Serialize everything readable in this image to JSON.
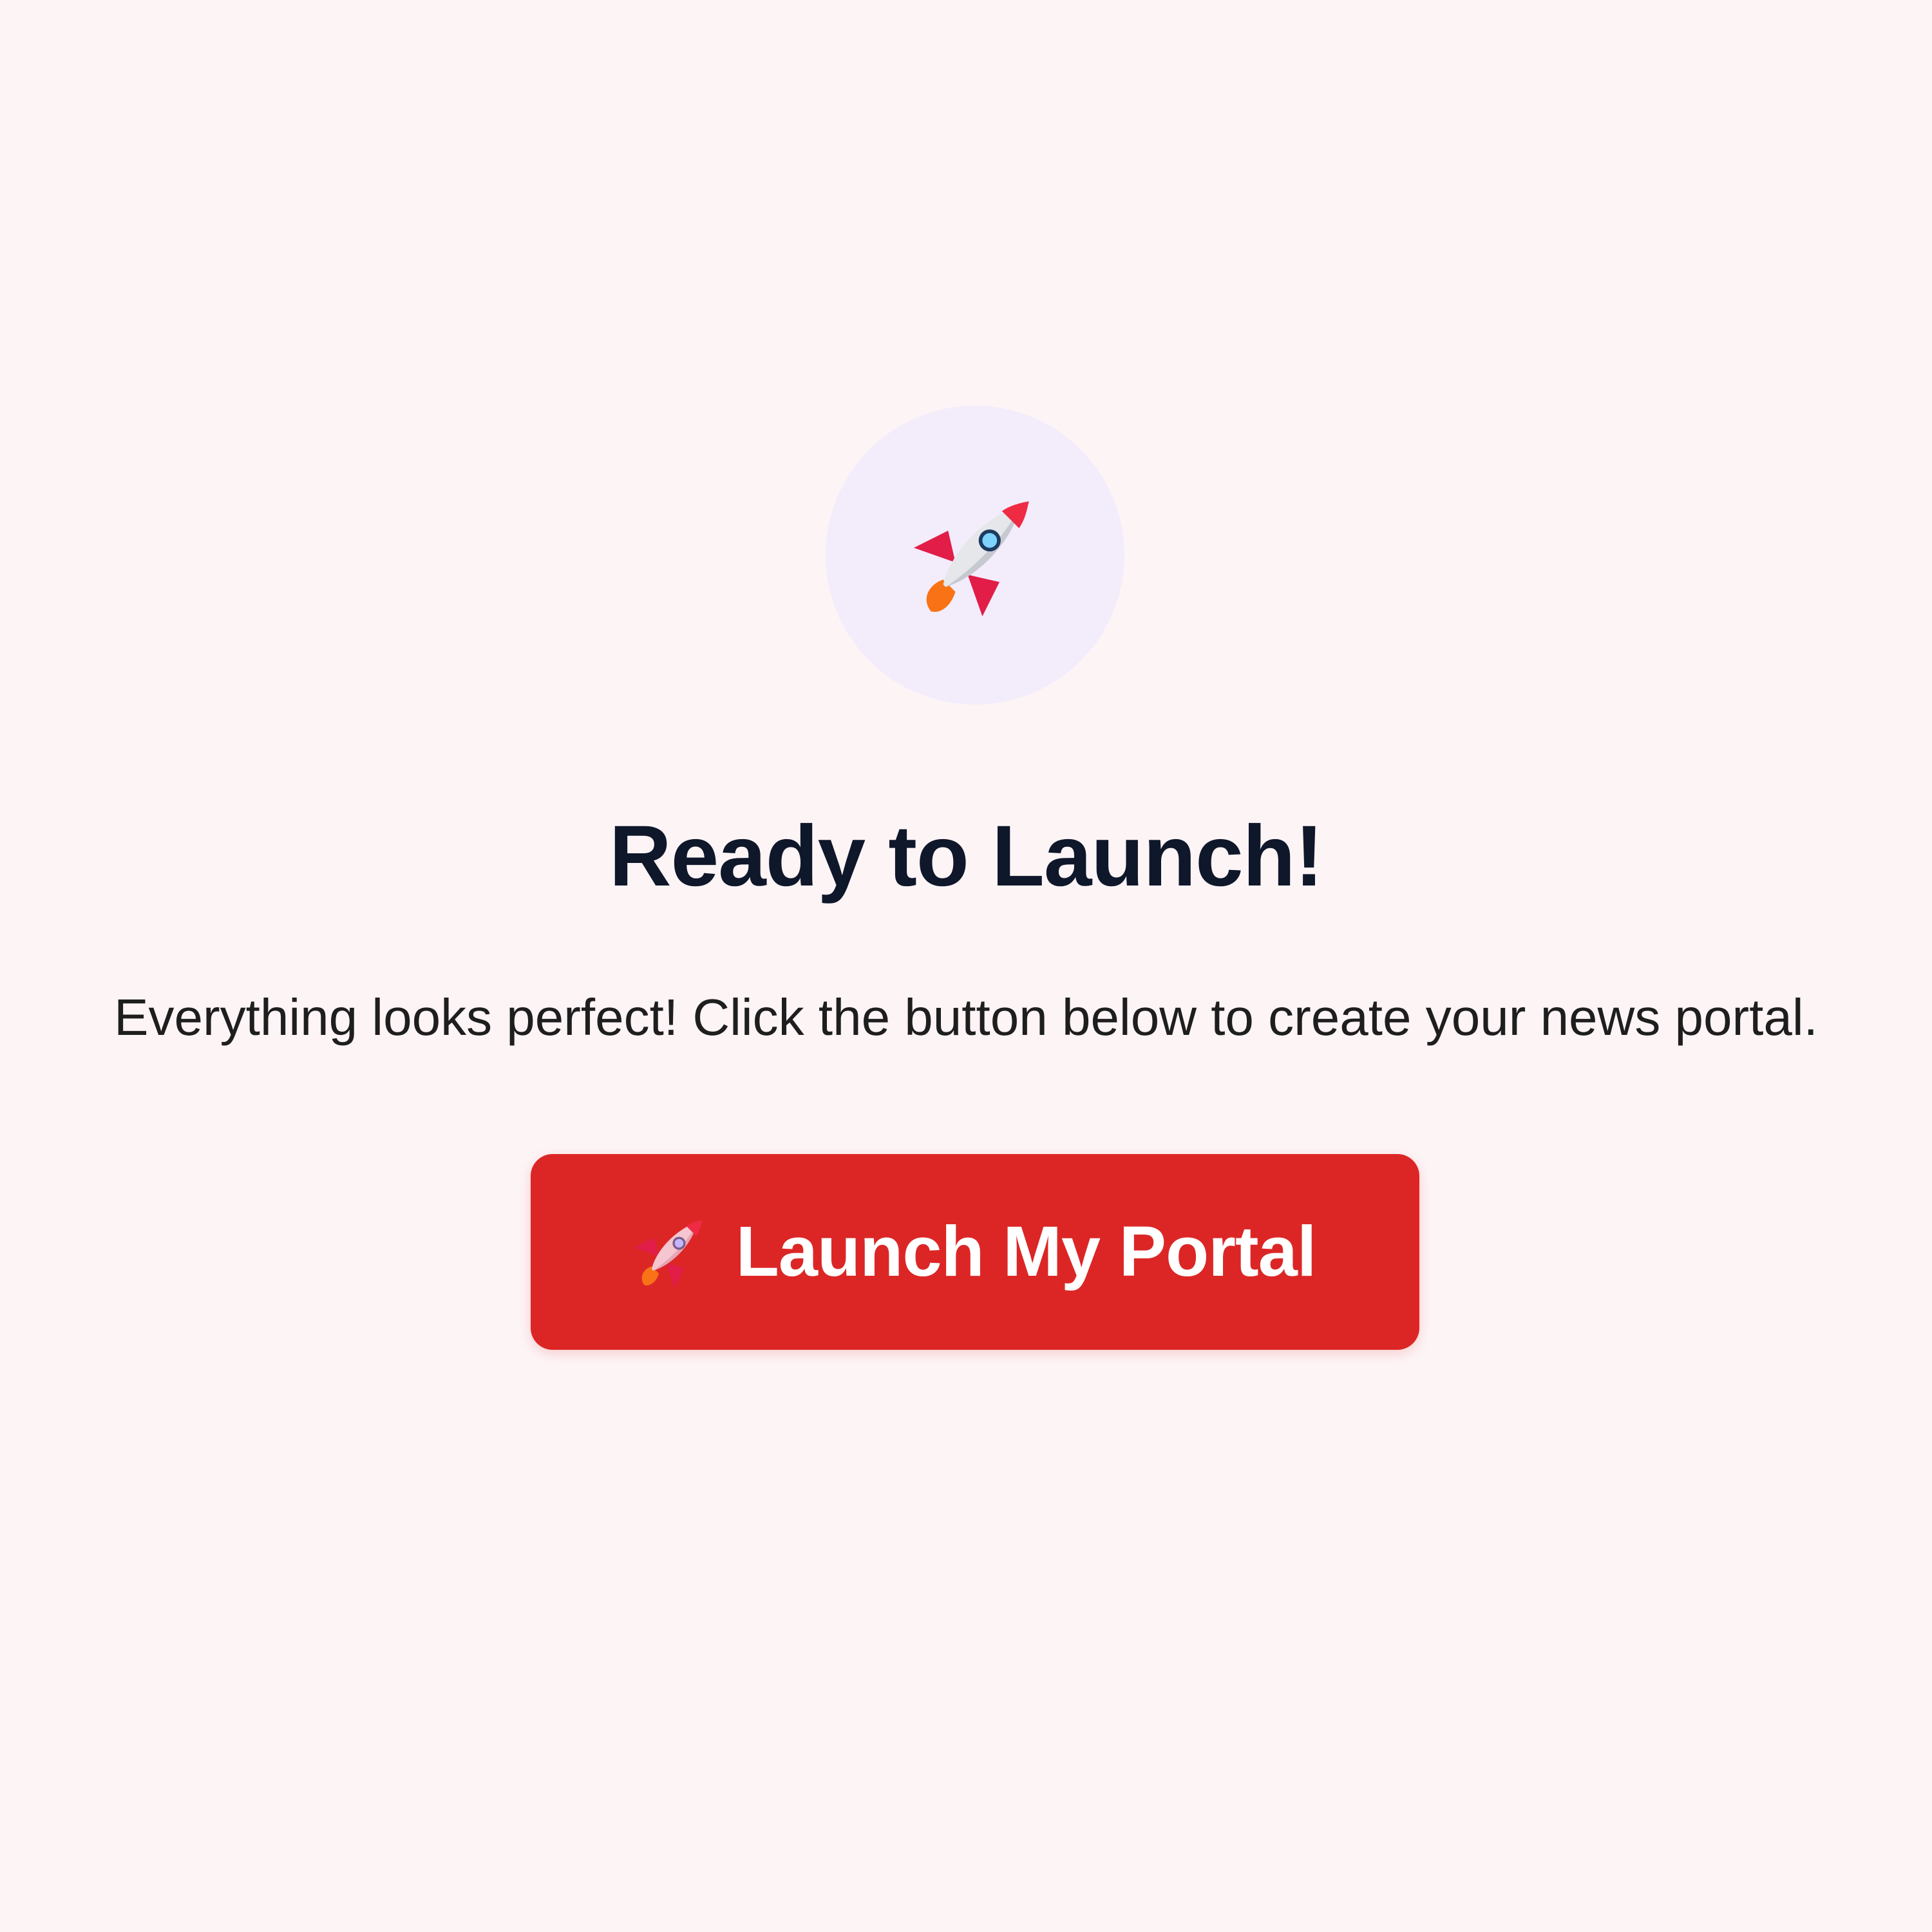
{
  "hero": {
    "icon": "rocket-icon",
    "circle_color": "#f3ecfb"
  },
  "title": "Ready to Launch!",
  "subtitle": "Everything looks perfect! Click the button below to create your news portal.",
  "launch_button": {
    "icon": "rocket-icon",
    "label": "Launch My Portal",
    "color": "#dc2626"
  },
  "colors": {
    "background": "#fdf4f6",
    "title": "#0f172a",
    "text": "#1e1e1e"
  }
}
